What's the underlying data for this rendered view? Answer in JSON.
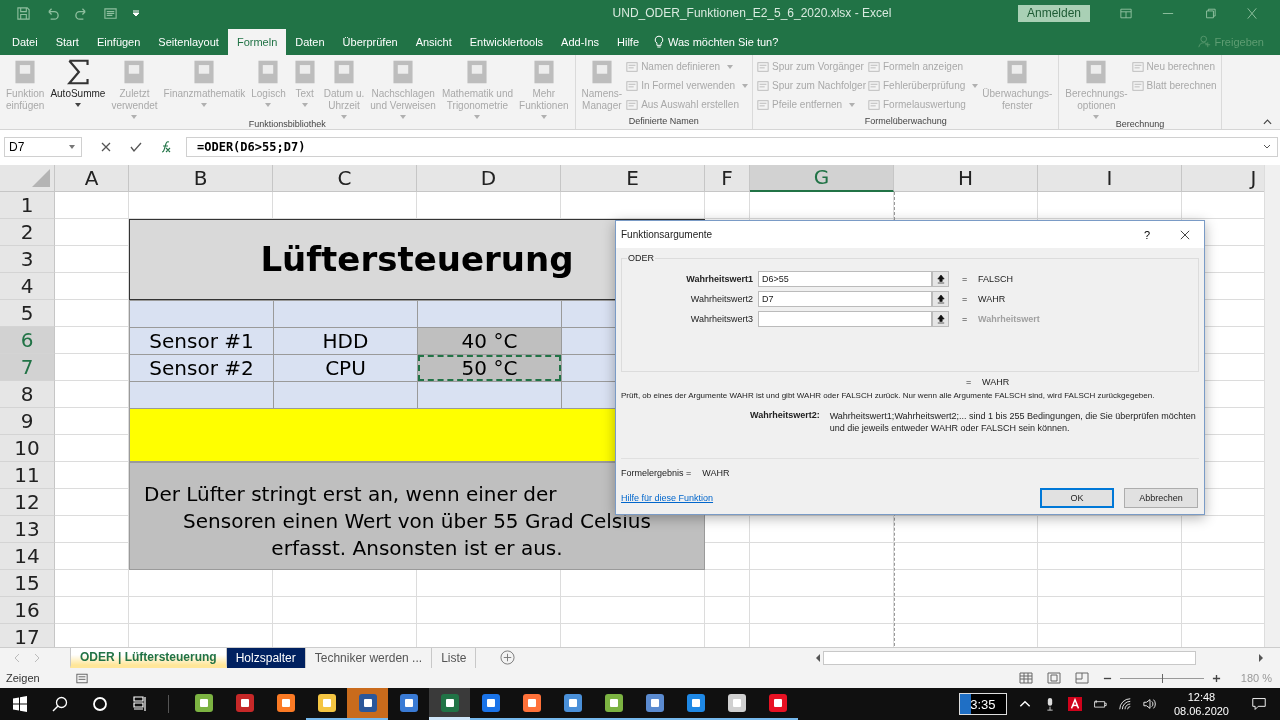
{
  "window": {
    "title": "UND_ODER_Funktionen_E2_5_6_2020.xlsx  -  Excel",
    "sign_in": "Anmelden"
  },
  "tabs": [
    {
      "label": "Datei",
      "selected": false
    },
    {
      "label": "Start",
      "selected": false
    },
    {
      "label": "Einfügen",
      "selected": false
    },
    {
      "label": "Seitenlayout",
      "selected": false
    },
    {
      "label": "Formeln",
      "selected": true
    },
    {
      "label": "Daten",
      "selected": false
    },
    {
      "label": "Überprüfen",
      "selected": false
    },
    {
      "label": "Ansicht",
      "selected": false
    },
    {
      "label": "Entwicklertools",
      "selected": false
    },
    {
      "label": "Add-Ins",
      "selected": false
    },
    {
      "label": "Hilfe",
      "selected": false
    }
  ],
  "tell_me": "Was möchten Sie tun?",
  "share": "Freigeben",
  "ribbon": {
    "groups": [
      {
        "label": "Funktionsbibliothek",
        "items": [
          {
            "kind": "large",
            "label": "Funktion\neinfügen",
            "disabled": true,
            "dropdown": false
          },
          {
            "kind": "large",
            "label": "AutoSumme",
            "disabled": false,
            "dropdown": true
          },
          {
            "kind": "large",
            "label": "Zuletzt\nverwendet",
            "disabled": true,
            "dropdown": true
          },
          {
            "kind": "large",
            "label": "Finanzmathematik",
            "disabled": true,
            "dropdown": true
          },
          {
            "kind": "large",
            "label": "Logisch",
            "disabled": true,
            "dropdown": true
          },
          {
            "kind": "large",
            "label": "Text",
            "disabled": true,
            "dropdown": true
          },
          {
            "kind": "large",
            "label": "Datum u.\nUhrzeit",
            "disabled": true,
            "dropdown": true
          },
          {
            "kind": "large",
            "label": "Nachschlagen\nund Verweisen",
            "disabled": true,
            "dropdown": true
          },
          {
            "kind": "large",
            "label": "Mathematik und\nTrigonometrie",
            "disabled": true,
            "dropdown": true
          },
          {
            "kind": "large",
            "label": "Mehr\nFunktionen",
            "disabled": true,
            "dropdown": true
          }
        ]
      },
      {
        "label": "Definierte Namen",
        "items": [
          {
            "kind": "large",
            "label": "Namens-\nManager",
            "disabled": true,
            "dropdown": false
          },
          {
            "kind": "small",
            "label": "Namen definieren",
            "disabled": true,
            "dropdown": true
          },
          {
            "kind": "small",
            "label": "In Formel verwenden",
            "disabled": true,
            "dropdown": true
          },
          {
            "kind": "small",
            "label": "Aus Auswahl erstellen",
            "disabled": true,
            "dropdown": false
          }
        ]
      },
      {
        "label": "Formelüberwachung",
        "items": [
          {
            "kind": "small",
            "label": "Spur zum Vorgänger",
            "disabled": true,
            "dropdown": false
          },
          {
            "kind": "small",
            "label": "Spur zum Nachfolger",
            "disabled": true,
            "dropdown": false
          },
          {
            "kind": "small",
            "label": "Pfeile entfernen",
            "disabled": true,
            "dropdown": true
          },
          {
            "kind": "small",
            "label": "Formeln anzeigen",
            "disabled": true,
            "dropdown": false
          },
          {
            "kind": "small",
            "label": "Fehlerüberprüfung",
            "disabled": true,
            "dropdown": true
          },
          {
            "kind": "small",
            "label": "Formelauswertung",
            "disabled": true,
            "dropdown": false
          },
          {
            "kind": "large",
            "label": "Überwachungs-\nfenster",
            "disabled": true,
            "dropdown": false
          }
        ]
      },
      {
        "label": "Berechnung",
        "items": [
          {
            "kind": "large",
            "label": "Berechnungs-\noptionen",
            "disabled": true,
            "dropdown": true
          },
          {
            "kind": "small",
            "label": "Neu berechnen",
            "disabled": true,
            "dropdown": false
          },
          {
            "kind": "small",
            "label": "Blatt berechnen",
            "disabled": true,
            "dropdown": false
          }
        ]
      }
    ]
  },
  "formula_bar": {
    "name_box": "D7",
    "formula": "=ODER(D6>55;D7)"
  },
  "sheet": {
    "columns": [
      {
        "label": "A",
        "selected": false
      },
      {
        "label": "B",
        "selected": false
      },
      {
        "label": "C",
        "selected": false
      },
      {
        "label": "D",
        "selected": false
      },
      {
        "label": "E",
        "selected": false
      },
      {
        "label": "F",
        "selected": false
      },
      {
        "label": "G",
        "selected": true
      },
      {
        "label": "H",
        "selected": false
      },
      {
        "label": "I",
        "selected": false
      },
      {
        "label": "J",
        "selected": false
      }
    ],
    "rows": [
      {
        "label": "1",
        "selected": false
      },
      {
        "label": "2",
        "selected": false
      },
      {
        "label": "3",
        "selected": false
      },
      {
        "label": "4",
        "selected": false
      },
      {
        "label": "5",
        "selected": false
      },
      {
        "label": "6",
        "selected": true
      },
      {
        "label": "7",
        "selected": true
      },
      {
        "label": "8",
        "selected": false
      },
      {
        "label": "9",
        "selected": false
      },
      {
        "label": "10",
        "selected": false
      },
      {
        "label": "11",
        "selected": false
      },
      {
        "label": "12",
        "selected": false
      },
      {
        "label": "13",
        "selected": false
      },
      {
        "label": "14",
        "selected": false
      },
      {
        "label": "15",
        "selected": false
      },
      {
        "label": "16",
        "selected": false
      },
      {
        "label": "17",
        "selected": false
      }
    ],
    "title": "Lüftersteuerung",
    "sensors": [
      {
        "label": "Sensor #1",
        "device": "HDD",
        "temperature": "40 °C",
        "copy_marked": false
      },
      {
        "label": "Sensor #2",
        "device": "CPU",
        "temperature": "50 °C",
        "copy_marked": true
      }
    ],
    "message_lines": [
      "Der Lüfter stringt erst an, wenn einer der",
      "Sensoren einen Wert von über 55 Grad Celsius",
      "erfasst. Ansonsten ist er aus."
    ]
  },
  "dialog": {
    "title": "Funktionsargumente",
    "help": "?",
    "function": "ODER",
    "arguments": [
      {
        "label": "Wahrheitswert1",
        "value": "D6>55",
        "sign": "=",
        "result": "FALSCH",
        "selected": true,
        "dimmed": false
      },
      {
        "label": "Wahrheitswert2",
        "value": "D7",
        "sign": "=",
        "result": "WAHR",
        "selected": false,
        "dimmed": false
      },
      {
        "label": "Wahrheitswert3",
        "sign": "=",
        "result": "Wahrheitswert",
        "selected": false,
        "dimmed": true
      }
    ],
    "total": {
      "sign": "=",
      "value": "WAHR"
    },
    "description": "Prüft, ob eines der Argumente WAHR ist und gibt WAHR oder FALSCH zurück. Nur wenn alle Argumente FALSCH sind, wird FALSCH zurückgegeben.",
    "argument_help": {
      "label": "Wahrheitswert2:",
      "text": "Wahrheitswert1;Wahrheitswert2;... sind 1 bis 255 Bedingungen, die Sie überprüfen möchten und die jeweils entweder WAHR oder FALSCH sein können."
    },
    "result_label": "Formelergebnis =",
    "result": "WAHR",
    "link": "Hilfe für diese Funktion",
    "buttons": [
      {
        "label": "OK",
        "selected": true
      },
      {
        "label": "Abbrechen",
        "selected": false
      }
    ]
  },
  "sheet_tabs": [
    {
      "label": "ODER | Lüftersteuerung",
      "selected": true,
      "color": "#ffe699"
    },
    {
      "label": "Holzspalter",
      "selected": false,
      "color": "#002060"
    },
    {
      "label": "Techniker werden ...",
      "selected": false
    },
    {
      "label": "Liste",
      "selected": false
    }
  ],
  "status_bar": {
    "mode": "Zeigen",
    "zoom": "180 %",
    "zoom_level": {
      "level": 0.5
    }
  },
  "taskbar": {
    "apps": [
      {
        "color": "#7cb342",
        "running": false,
        "selected": false,
        "attention": false
      },
      {
        "color": "#c62828",
        "running": false,
        "selected": false,
        "attention": false
      },
      {
        "color": "#fb7a24",
        "running": false,
        "selected": false,
        "attention": false
      },
      {
        "color": "#f4c542",
        "running": true,
        "selected": false,
        "attention": false
      },
      {
        "color": "#2b579a",
        "running": true,
        "selected": false,
        "attention": true
      },
      {
        "color": "#3a7bd5",
        "running": false,
        "selected": false,
        "attention": false
      },
      {
        "color": "#217346",
        "running": true,
        "selected": true,
        "attention": false
      },
      {
        "color": "#1a73e8",
        "running": true,
        "selected": false,
        "attention": false
      },
      {
        "color": "#ff7139",
        "running": true,
        "selected": false,
        "attention": false
      },
      {
        "color": "#4a90d9",
        "running": true,
        "selected": false,
        "attention": false
      },
      {
        "color": "#7cb342",
        "running": true,
        "selected": false,
        "attention": false
      },
      {
        "color": "#5b8bd0",
        "running": true,
        "selected": false,
        "attention": false
      },
      {
        "color": "#1e88e5",
        "running": true,
        "selected": false,
        "attention": false
      },
      {
        "color": "#d0d0d0",
        "running": true,
        "selected": false,
        "attention": false
      },
      {
        "color": "#e81123",
        "running": true,
        "selected": false,
        "attention": false
      }
    ],
    "timer": {
      "text": "3:35",
      "level": 0.25
    },
    "time": "12:48",
    "date": "08.06.2020"
  }
}
